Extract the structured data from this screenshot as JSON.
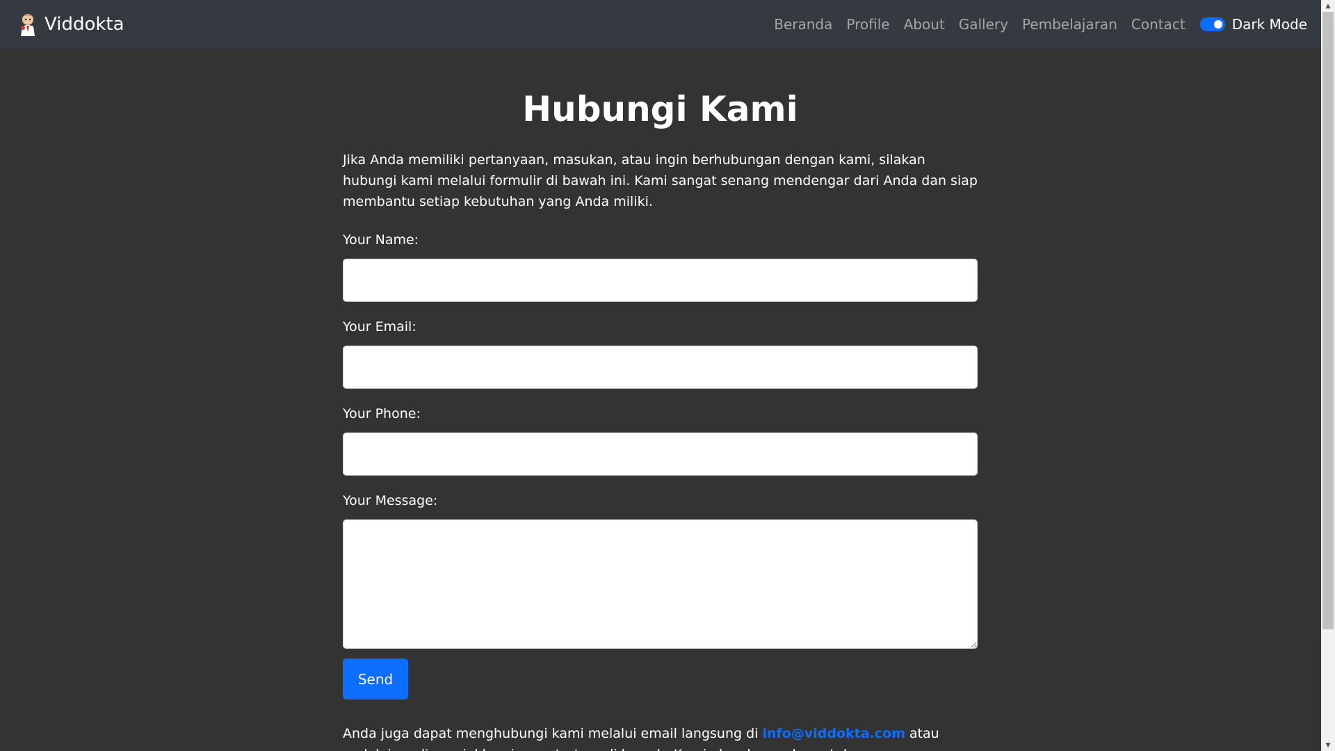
{
  "nav": {
    "brand": "Viddokta",
    "links": [
      "Beranda",
      "Profile",
      "About",
      "Gallery",
      "Pembelajaran",
      "Contact"
    ],
    "toggle_label": "Dark Mode",
    "toggle_on": true
  },
  "main": {
    "title": "Hubungi Kami",
    "intro": "Jika Anda memiliki pertanyaan, masukan, atau ingin berhubungan dengan kami, silakan hubungi kami melalui formulir di bawah ini. Kami sangat senang mendengar dari Anda dan siap membantu setiap kebutuhan yang Anda miliki.",
    "form": {
      "name_label": "Your Name:",
      "name_value": "",
      "email_label": "Your Email:",
      "email_value": "",
      "phone_label": "Your Phone:",
      "phone_value": "",
      "message_label": "Your Message:",
      "message_value": "",
      "send_label": "Send"
    },
    "footer_before": "Anda juga dapat menghubungi kami melalui email langsung di ",
    "footer_email": "info@viddokta.com",
    "footer_after": " atau melalui media sosial kami yang tertera di bawah. Kami akan berusaha untuk merespons secepat mungkin."
  },
  "colors": {
    "background": "#333333",
    "navbar": "#343a40",
    "accent": "#0d6efd"
  }
}
